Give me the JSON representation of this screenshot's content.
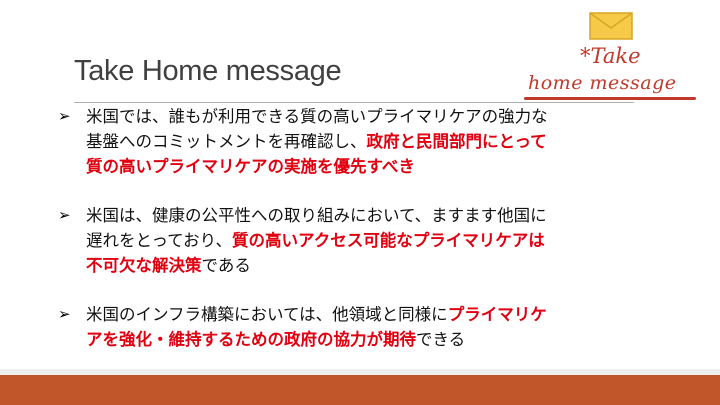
{
  "title": "Take Home message",
  "stamp": {
    "line1": "*Take",
    "line2": "home message"
  },
  "bullets": [
    {
      "l1": "米国では、誰もが利用できる質の高いプライマリケアの強力な",
      "l2a": "基盤へのコミットメントを再確認し、",
      "l2b": "政府と民間部門にとって",
      "l3": "質の高いプライマリケアの実施を優先すべき"
    },
    {
      "l1": "米国は、健康の公平性への取り組みにおいて、ますます他国に",
      "l2a": "遅れをとっており、",
      "l2b": "質の高いアクセス可能なプライマリケアは",
      "l3a": "不可欠な解決策",
      "l3b": "である"
    },
    {
      "l1a": "米国のインフラ構築においては、他領域と同様に",
      "l1b": "プライマリケ",
      "l2a": "アを強化・維持するための政府の協力が期待",
      "l2b": "できる"
    }
  ],
  "colors": {
    "emphasis": "#e0000f",
    "footer": "#c0562a",
    "title": "#404040"
  },
  "icons": [
    "envelope-icon",
    "arrow-bullet-icon"
  ]
}
